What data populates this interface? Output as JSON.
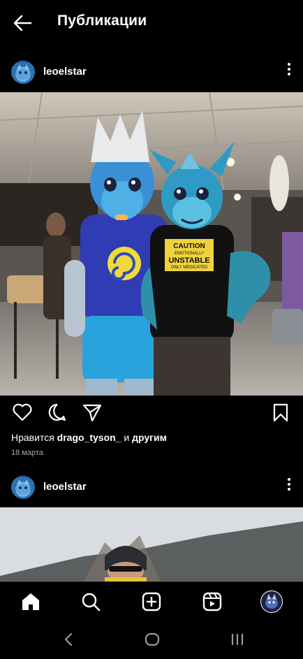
{
  "header": {
    "title": "Публикации"
  },
  "posts": [
    {
      "username": "leoelstar",
      "liked_by_prefix": "Нравится ",
      "liked_by_user": "drago_tyson_",
      "liked_by_suffix": " и ",
      "liked_by_others": "другим",
      "date": "18 марта",
      "shirt_text": [
        "CAUTION",
        "EMOTIONALLY",
        "UNSTABLE",
        "ONLY MEDICATED"
      ]
    },
    {
      "username": "leoelstar"
    }
  ],
  "icons": {
    "back": "arrow-left-icon",
    "more": "more-vertical-icon",
    "like": "heart-icon",
    "comment": "comment-icon",
    "share": "send-icon",
    "save": "bookmark-icon",
    "home": "home-icon",
    "search": "search-icon",
    "create": "plus-square-icon",
    "reels": "reels-icon",
    "profile": "profile-avatar",
    "sys_back": "chevron-left-icon",
    "sys_home": "circle-home-icon",
    "sys_recent": "recent-apps-icon"
  },
  "colors": {
    "background": "#000000",
    "text": "#ffffff",
    "muted": "#a8a8a8",
    "divider": "#262626"
  }
}
